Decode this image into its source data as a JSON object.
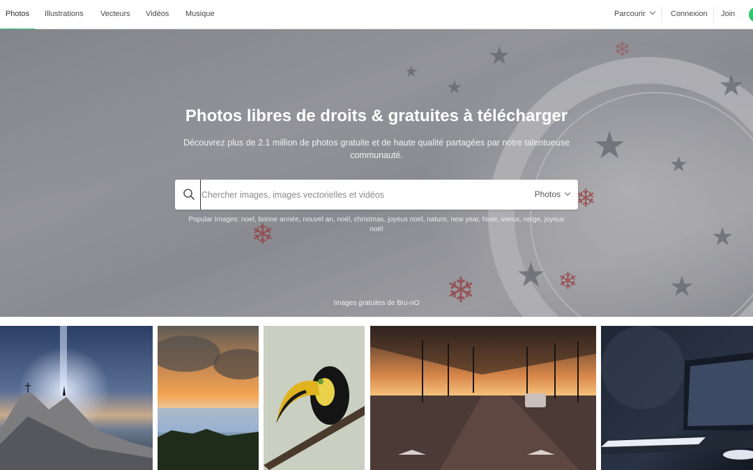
{
  "nav": {
    "tabs": [
      {
        "label": "Photos",
        "active": true
      },
      {
        "label": "Illustrations",
        "active": false
      },
      {
        "label": "Vecteurs",
        "active": false
      },
      {
        "label": "Vidéos",
        "active": false
      },
      {
        "label": "Musique",
        "active": false
      }
    ],
    "browse_label": "Parcourir",
    "login_label": "Connexion",
    "join_label": "Join",
    "accent_color": "#2ec66d"
  },
  "hero": {
    "title": "Photos libres de droits & gratuites à télécharger",
    "subtitle": "Découvrez plus de 2.1 million de photos gratuite et de haute qualité partagées par notre talentueuse communauté.",
    "search": {
      "placeholder": "Chercher images, images vectorielles et vidéos",
      "value": "",
      "type_label": "Photos",
      "icon": "search-icon"
    },
    "popular_prefix": "Popular Images:",
    "popular_tags": [
      "noel",
      "bonne année",
      "nouvel an",
      "noël",
      "christmas",
      "joyeux noel",
      "nature",
      "new year",
      "hiver",
      "voeux",
      "neige",
      "joyeux noël"
    ],
    "credit": "Images gratuites de Bru-nO"
  },
  "gallery": [
    {
      "subject": "mountain-summit-night"
    },
    {
      "subject": "sunset-clouds-lake"
    },
    {
      "subject": "toucan-on-branch"
    },
    {
      "subject": "street-sunset-lamps"
    },
    {
      "subject": "laptop-dark-desk"
    }
  ]
}
